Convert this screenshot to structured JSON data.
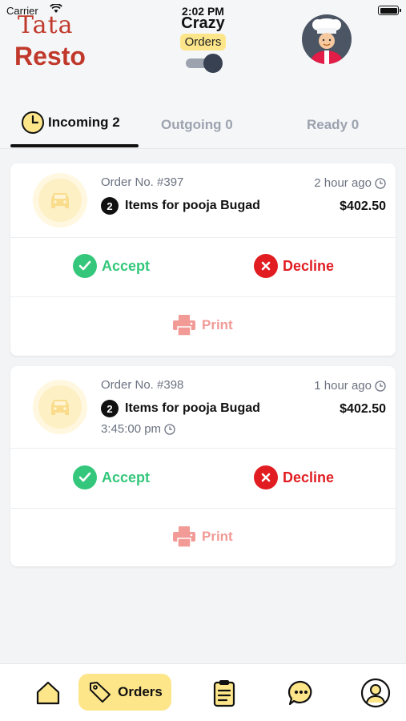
{
  "status_bar": {
    "carrier": "Carrier",
    "time": "2:02 PM"
  },
  "logo": {
    "top": "Tata",
    "bottom": "Resto"
  },
  "header": {
    "title": "Crazy",
    "pill": "Orders",
    "toggle_on": true
  },
  "tabs": {
    "incoming": "Incoming 2",
    "outgoing": "Outgoing 0",
    "ready": "Ready 0"
  },
  "orders": [
    {
      "order_no": "Order No. #397",
      "ago": "2 hour ago",
      "count": "2",
      "items": "Items for pooja Bugad",
      "price": "$402.50",
      "accept": "Accept",
      "decline": "Decline",
      "print": "Print"
    },
    {
      "order_no": "Order No. #398",
      "ago": "1 hour ago",
      "count": "2",
      "items": "Items for pooja Bugad",
      "price": "$402.50",
      "time": "3:45:00 pm",
      "accept": "Accept",
      "decline": "Decline",
      "print": "Print"
    }
  ],
  "bottom_nav": {
    "orders": "Orders"
  },
  "colors": {
    "accent": "#fde68a",
    "accept": "#34c77b",
    "decline": "#e11d22",
    "print": "#f19a96",
    "logo": "#c0392b"
  }
}
